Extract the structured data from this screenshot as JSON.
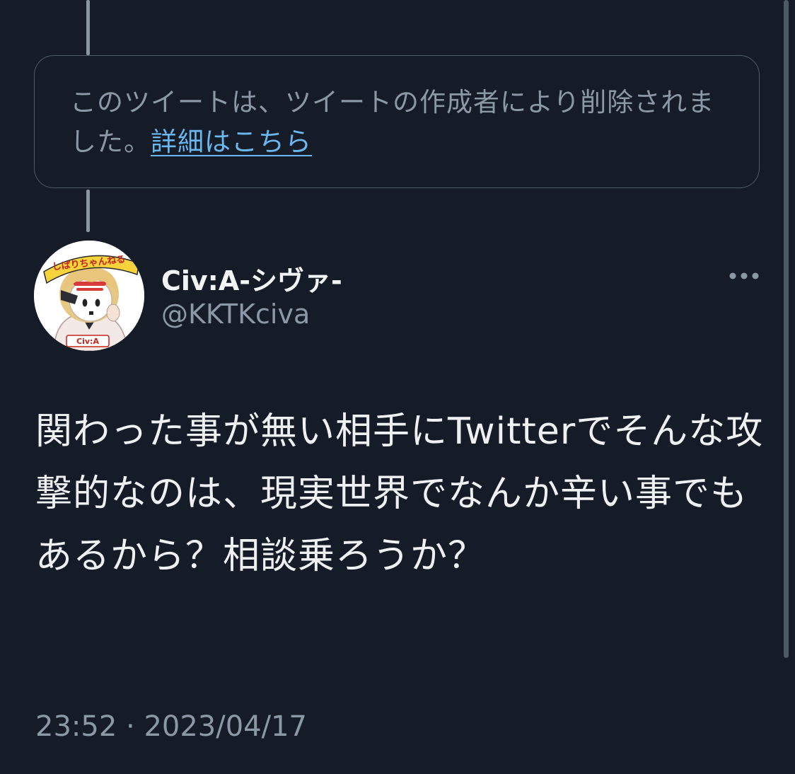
{
  "deleted_notice": {
    "text": "このツイートは、ツイートの作成者により削除されました。",
    "link": "詳細はこちら"
  },
  "tweet": {
    "display_name": "Civ:A-シヴァ-",
    "handle": "@KKTKciva",
    "avatar_banner_text": "しばりちゃんねる",
    "avatar_badge_text": "Civ:A",
    "body": "関わった事が無い相手にTwitterでそんな攻撃的なのは、現実世界でなんか辛い事でもあるから？相談乗ろうか？",
    "time": "23:52",
    "separator": "·",
    "date": "2023/04/17"
  },
  "icons": {
    "more": "more-dots-icon"
  },
  "colors": {
    "background": "#161c27",
    "link": "#6ab7ef",
    "muted": "#8b98a5"
  }
}
